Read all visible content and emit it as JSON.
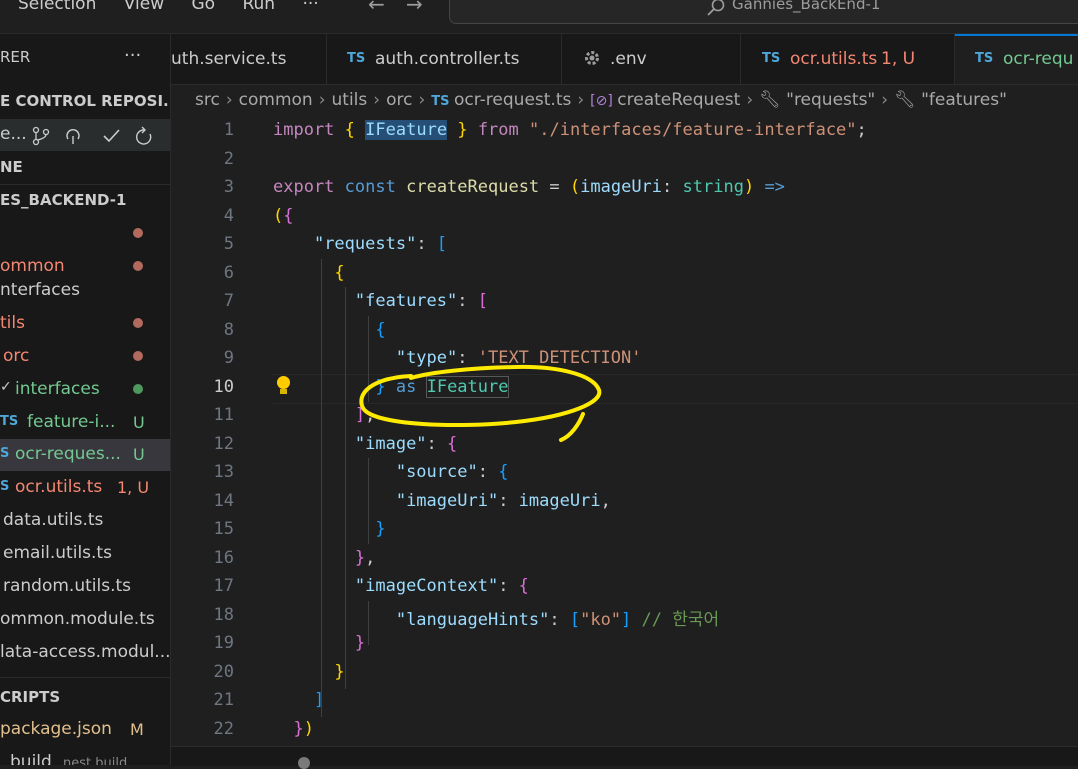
{
  "menu": {
    "items": [
      "Selection",
      "View",
      "Go",
      "Run",
      "···"
    ],
    "back_glyph": "←",
    "forward_glyph": "→"
  },
  "command_center": {
    "text": "Gannies_BackEnd-1",
    "icon": "search-icon"
  },
  "sidebar": {
    "title": "RER",
    "more": "···",
    "source_control_title": "E CONTROL REPOSI...",
    "scm_row_text": "e...",
    "scm_icons": [
      "branch-icon",
      "sync-icon",
      "check-icon",
      "refresh-icon"
    ],
    "outline_title": "NE",
    "repo_title": "ES_BACKEND-1",
    "tree": [
      {
        "label": "",
        "color": "#cccccc",
        "status": "dot-red"
      },
      {
        "label": "ommon",
        "color": "#f48771",
        "status": "dot-red"
      },
      {
        "label": "nterfaces",
        "color": "#cccccc",
        "status": ""
      },
      {
        "label": "tils",
        "color": "#f48771",
        "status": "dot-red"
      },
      {
        "label": "orc",
        "color": "#f48771",
        "status": "dot-red"
      },
      {
        "label": "interfaces",
        "color": "#73c991",
        "status": "dot-green",
        "chevron": "✓"
      },
      {
        "label": "feature-i...",
        "color": "#73c991",
        "status": "U",
        "ts": "TS"
      },
      {
        "label": "ocr-reques...",
        "color": "#73c991",
        "status": "U",
        "ts": "S"
      },
      {
        "label": "ocr.utils.ts",
        "color": "#f48771",
        "status": "1, U",
        "ts": "S"
      },
      {
        "label": "data.utils.ts",
        "color": "#cccccc",
        "status": ""
      },
      {
        "label": "email.utils.ts",
        "color": "#cccccc",
        "status": ""
      },
      {
        "label": "random.utils.ts",
        "color": "#cccccc",
        "status": ""
      },
      {
        "label": "ommon.module.ts",
        "color": "#cccccc",
        "status": ""
      },
      {
        "label": "lata-access.modul...",
        "color": "#cccccc",
        "status": ""
      }
    ],
    "npm_title": "CRIPTS",
    "package_json": {
      "label": "package.json",
      "status": "M"
    },
    "build": {
      "label": "build",
      "hint": "nest build"
    }
  },
  "tabs": [
    {
      "label": "uth.service.ts",
      "ts": ""
    },
    {
      "label": "auth.controller.ts",
      "ts": "TS"
    },
    {
      "label": ".env",
      "ts": "",
      "icon": "gear-icon"
    },
    {
      "label": "ocr.utils.ts",
      "badge": "1, U",
      "ts": "TS"
    },
    {
      "label": "ocr-requ",
      "ts": "TS"
    }
  ],
  "breadcrumb": [
    "src",
    "common",
    "utils",
    "orc",
    "ocr-request.ts",
    "createRequest",
    "\"requests\"",
    "\"features\""
  ],
  "editor": {
    "active_line": 10,
    "line_numbers": [
      "1",
      "2",
      "3",
      "4",
      "5",
      "6",
      "7",
      "8",
      "9",
      "10",
      "11",
      "12",
      "13",
      "14",
      "15",
      "16",
      "17",
      "18",
      "19",
      "20",
      "21",
      "22"
    ]
  }
}
